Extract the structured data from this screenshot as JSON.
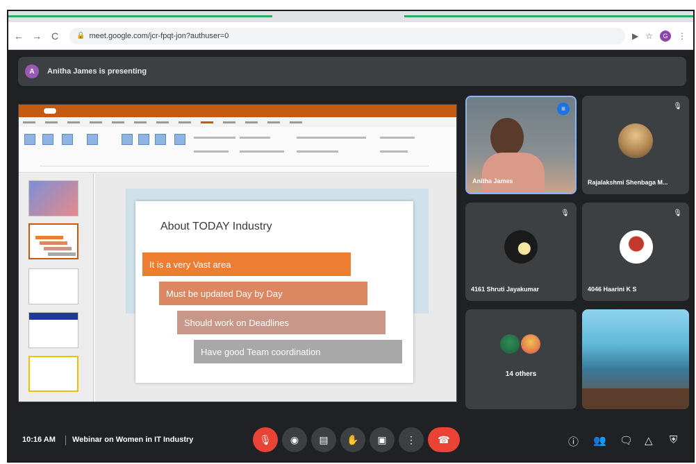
{
  "browser": {
    "url": "meet.google.com/jcr-fpqt-jon?authuser=0",
    "profile_initial": "G"
  },
  "presenting": {
    "avatar_initial": "A",
    "text": "Anitha James is presenting"
  },
  "slide": {
    "heading": "About TODAY Industry",
    "bullets": [
      {
        "text": "It is a very Vast area",
        "color": "#ed7d31"
      },
      {
        "text": "Must be updated Day by Day",
        "color": "#db8761"
      },
      {
        "text": "Should work on Deadlines",
        "color": "#c9978a"
      },
      {
        "text": "Have good Team coordination",
        "color": "#a8a8a8"
      }
    ]
  },
  "participants": [
    {
      "name": "Anitha James",
      "speaking": true
    },
    {
      "name": "Rajalakshmi Shenbaga M..."
    },
    {
      "name": "4161 Shruti Jayakumar"
    },
    {
      "name": "4046 Haarini K S"
    },
    {
      "name": "14 others"
    }
  ],
  "meeting": {
    "time": "10:16 AM",
    "title": "Webinar on Women in IT Industry"
  },
  "colors": {
    "accent": "#8ab4f8",
    "danger": "#ea4335",
    "ppt_brand": "#c55a11"
  },
  "icons": {
    "back": "←",
    "forward": "→",
    "reload": "C",
    "mic_off": "🎙",
    "camera": "◉",
    "captions": "▤",
    "hand": "✋",
    "present": "▣",
    "more": "⋮",
    "hangup": "☎",
    "info": "ⓘ",
    "people": "👥",
    "chat": "🗨",
    "activities": "△",
    "host_controls": "⛨"
  }
}
